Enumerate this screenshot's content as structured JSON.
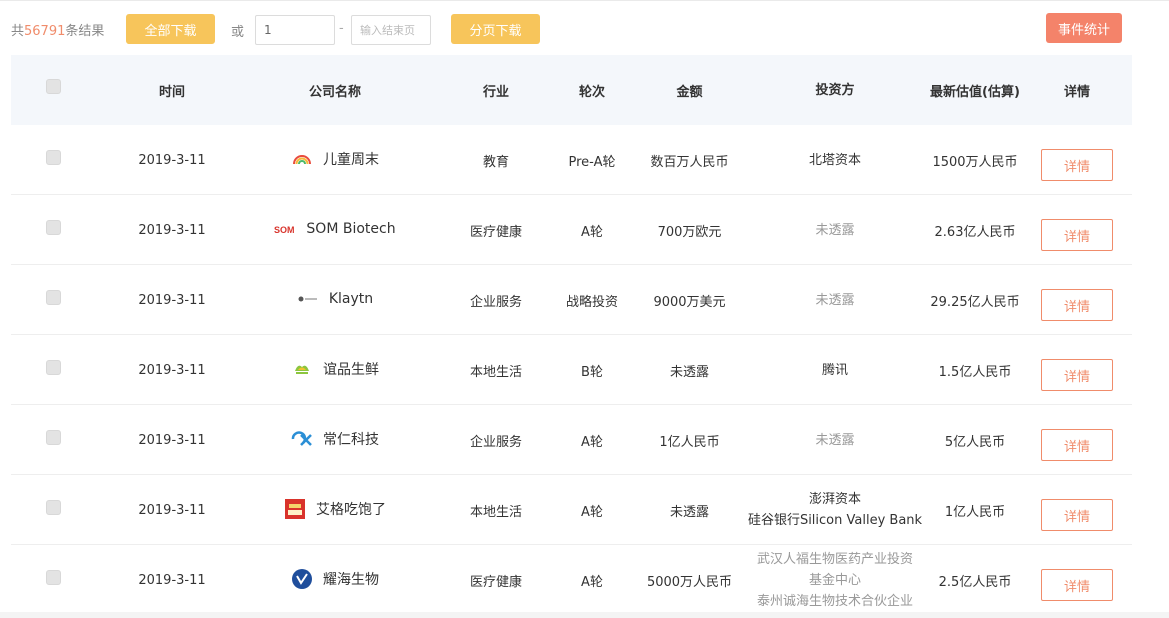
{
  "toolbar": {
    "total_prefix": "共",
    "total_count": "56791",
    "total_suffix": "条结果",
    "download_all_label": "全部下载",
    "or_label": "或",
    "page_start_value": "1",
    "page_dash": "-",
    "page_end_placeholder": "输入结束页",
    "download_page_label": "分页下载",
    "stats_label": "事件统计"
  },
  "columns": {
    "time": "时间",
    "company": "公司名称",
    "industry": "行业",
    "round": "轮次",
    "amount": "金额",
    "investor": "投资方",
    "valuation": "最新估值(估算)",
    "detail": "详情"
  },
  "rows": [
    {
      "time": "2019-3-11",
      "company": "儿童周末",
      "logo": "rainbow-logo",
      "industry": "教育",
      "round": "Pre-A轮",
      "amount": "数百万人民币",
      "investor_lines": [
        "北塔资本"
      ],
      "investor_muted": false,
      "valuation": "1500万人民币",
      "detail": "详情"
    },
    {
      "time": "2019-3-11",
      "company": "SOM Biotech",
      "logo": "som-logo",
      "logo_text": "SOM",
      "industry": "医疗健康",
      "round": "A轮",
      "amount": "700万欧元",
      "investor_lines": [
        "未透露"
      ],
      "investor_muted": true,
      "valuation": "2.63亿人民币",
      "detail": "详情"
    },
    {
      "time": "2019-3-11",
      "company": "Klaytn",
      "logo": "klaytn-logo",
      "industry": "企业服务",
      "round": "战略投资",
      "amount": "9000万美元",
      "investor_lines": [
        "未透露"
      ],
      "investor_muted": true,
      "valuation": "29.25亿人民币",
      "detail": "详情"
    },
    {
      "time": "2019-3-11",
      "company": "谊品生鲜",
      "logo": "leaf-logo",
      "industry": "本地生活",
      "round": "B轮",
      "amount": "未透露",
      "investor_lines": [
        "腾讯"
      ],
      "investor_muted": false,
      "valuation": "1.5亿人民币",
      "detail": "详情"
    },
    {
      "time": "2019-3-11",
      "company": "常仁科技",
      "logo": "changren-logo",
      "industry": "企业服务",
      "round": "A轮",
      "amount": "1亿人民币",
      "investor_lines": [
        "未透露"
      ],
      "investor_muted": true,
      "valuation": "5亿人民币",
      "detail": "详情"
    },
    {
      "time": "2019-3-11",
      "company": "艾格吃饱了",
      "logo": "aige-logo",
      "industry": "本地生活",
      "round": "A轮",
      "amount": "未透露",
      "investor_lines": [
        "澎湃资本",
        "硅谷银行Silicon Valley Bank"
      ],
      "investor_muted": false,
      "valuation": "1亿人民币",
      "detail": "详情"
    },
    {
      "time": "2019-3-11",
      "company": "耀海生物",
      "logo": "yaohai-logo",
      "industry": "医疗健康",
      "round": "A轮",
      "amount": "5000万人民币",
      "investor_lines": [
        "武汉人福生物医药产业投资",
        "基金中心",
        "泰州诚海生物技术合伙企业"
      ],
      "investor_muted": true,
      "valuation": "2.5亿人民币",
      "detail": "详情"
    }
  ],
  "colors": {
    "accent": "#f08c6b",
    "yellow_button": "#f7c55b",
    "stats_button": "#f4836a",
    "header_bg": "#f4f7fb"
  }
}
